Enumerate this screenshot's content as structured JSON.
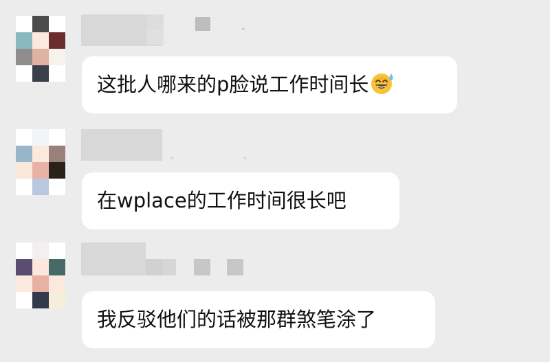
{
  "messages": [
    {
      "text": "这批人哪来的p脸说工作时间长",
      "emoji": "sweat-smile-emoji",
      "sender_obscured": true,
      "avatar_pixels": [
        "#ffffff",
        "#4b4b4b",
        "#ffffff",
        "#8ab8bf",
        "#fbe9dd",
        "#6b2e2e",
        "#8e8c8c",
        "#e0b2a4",
        "#f7f3ec",
        "#ffffff",
        "#3a3f4a",
        "#ffffff"
      ]
    },
    {
      "text": "在wplace的工作时间很长吧",
      "sender_obscured": true,
      "avatar_pixels": [
        "#ffffff",
        "#f3f4f6",
        "#ffffff",
        "#97b6c9",
        "#fbe9dd",
        "#9a807a",
        "#f9e8dc",
        "#e9b2a7",
        "#2a211a",
        "#ffffff",
        "#b8c8de",
        "#ffffff"
      ]
    },
    {
      "text": "我反驳他们的话被那群煞笔涂了",
      "sender_obscured": true,
      "avatar_pixels": [
        "#ffffff",
        "#f2efef",
        "#ffffff",
        "#5a4d70",
        "#fbe7dc",
        "#466a66",
        "#fbe9dd",
        "#e9b0a4",
        "#fbe9dd",
        "#ffffff",
        "#323a4c",
        "#f5efd9"
      ]
    }
  ],
  "colors": {
    "background": "#ececec",
    "bubble": "#ffffff",
    "text": "#111111",
    "name_redaction": "#dcdcdc"
  }
}
